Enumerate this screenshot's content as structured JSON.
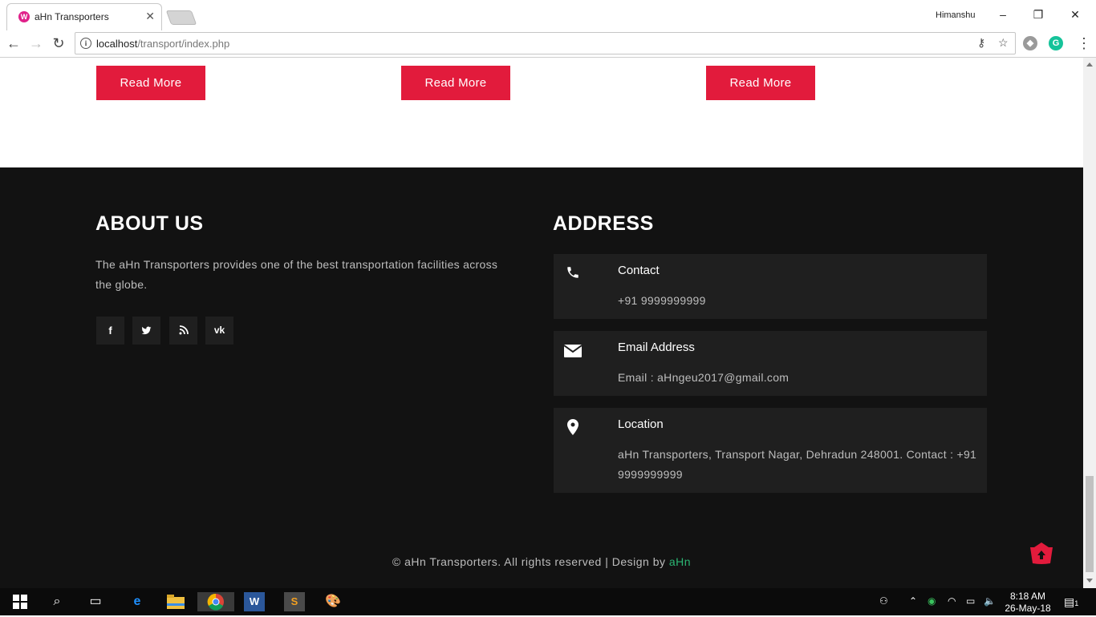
{
  "browser": {
    "tab_title": "aHn Transporters",
    "profile_name": "Himanshu",
    "url_host": "localhost",
    "url_path": "/transport/index.php"
  },
  "upper": {
    "read_more_labels": [
      "Read More",
      "Read More",
      "Read More"
    ]
  },
  "footer": {
    "about_heading": "ABOUT US",
    "about_text": "The aHn Transporters provides one of the best transportation facilities across the globe.",
    "social_icons": [
      "facebook-icon",
      "twitter-icon",
      "rss-icon",
      "vk-icon"
    ],
    "address_heading": "ADDRESS",
    "contact": {
      "title": "Contact",
      "text": "+91 9999999999"
    },
    "email": {
      "title": "Email Address",
      "text": "Email : aHngeu2017@gmail.com"
    },
    "location": {
      "title": "Location",
      "text": "aHn Transporters, Transport Nagar, Dehradun 248001. Contact : +91 9999999999"
    },
    "copyright_prefix": "© aHn Transporters. All rights reserved | Design by ",
    "copyright_brand": "aHn"
  },
  "taskbar": {
    "time": "8:18 AM",
    "date": "26-May-18",
    "notification_count": "1"
  },
  "colors": {
    "accent_red": "#e21b3c",
    "footer_bg": "#121212",
    "card_bg": "#1f1f1f",
    "brand_green": "#2bb673"
  }
}
